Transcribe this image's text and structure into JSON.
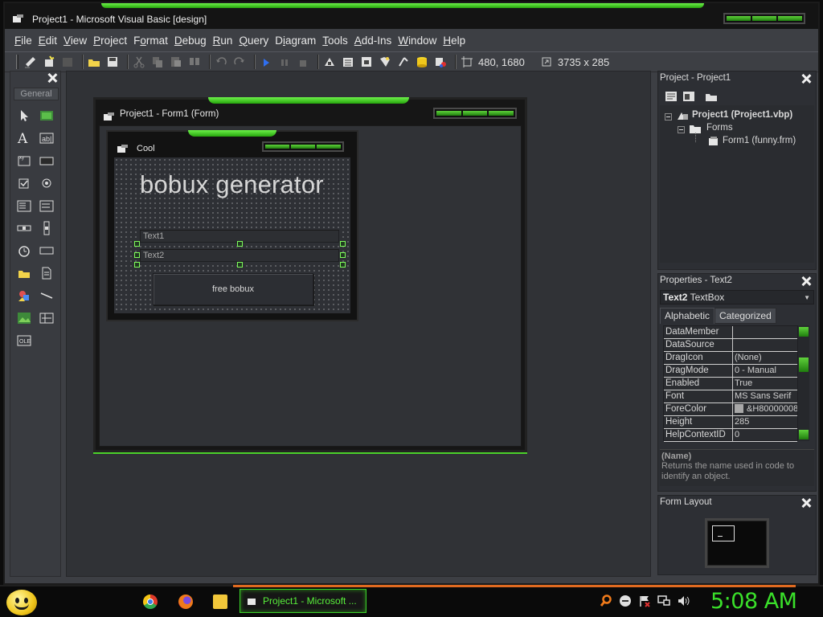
{
  "window": {
    "title": "Project1 - Microsoft Visual Basic [design]"
  },
  "menu": [
    {
      "pre": "",
      "u": "F",
      "post": "ile"
    },
    {
      "pre": "",
      "u": "E",
      "post": "dit"
    },
    {
      "pre": "",
      "u": "V",
      "post": "iew"
    },
    {
      "pre": "",
      "u": "P",
      "post": "roject"
    },
    {
      "pre": "F",
      "u": "o",
      "post": "rmat"
    },
    {
      "pre": "",
      "u": "D",
      "post": "ebug"
    },
    {
      "pre": "",
      "u": "R",
      "post": "un"
    },
    {
      "pre": "",
      "u": "Q",
      "post": "uery"
    },
    {
      "pre": "D",
      "u": "i",
      "post": "agram"
    },
    {
      "pre": "",
      "u": "T",
      "post": "ools"
    },
    {
      "pre": "",
      "u": "A",
      "post": "dd-Ins"
    },
    {
      "pre": "",
      "u": "W",
      "post": "indow"
    },
    {
      "pre": "",
      "u": "H",
      "post": "elp"
    }
  ],
  "toolbar": {
    "position": "480, 1680",
    "size": "3735 x 285"
  },
  "toolbox": {
    "tab": "General"
  },
  "form_designer": {
    "title": "Project1 - Form1 (Form)"
  },
  "form": {
    "caption": "Cool",
    "label": "bobux generator",
    "text1": "Text1",
    "text2": "Text2",
    "button": "free bobux"
  },
  "project_panel": {
    "title": "Project - Project1",
    "project": "Project1 (Project1.vbp)",
    "folder": "Forms",
    "form_file": "Form1 (funny.frm)"
  },
  "properties_panel": {
    "title": "Properties - Text2",
    "object_name": "Text2",
    "object_type": "TextBox",
    "tabs": [
      "Alphabetic",
      "Categorized"
    ],
    "rows": [
      {
        "name": "DataMember",
        "value": ""
      },
      {
        "name": "DataSource",
        "value": ""
      },
      {
        "name": "DragIcon",
        "value": "(None)"
      },
      {
        "name": "DragMode",
        "value": "0 - Manual"
      },
      {
        "name": "Enabled",
        "value": "True"
      },
      {
        "name": "Font",
        "value": "MS Sans Serif"
      },
      {
        "name": "ForeColor",
        "value": "&H80000008"
      },
      {
        "name": "Height",
        "value": "285"
      },
      {
        "name": "HelpContextID",
        "value": "0"
      }
    ],
    "desc_name": "(Name)",
    "desc_text": "Returns the name used in code to identify an object."
  },
  "layout_panel": {
    "title": "Form Layout"
  },
  "taskbar": {
    "task": "Project1 - Microsoft ...",
    "clock": "5:08 AM"
  },
  "colors": {
    "accent_green": "#3ae02a",
    "taskbar_orange": "#e06a20"
  }
}
